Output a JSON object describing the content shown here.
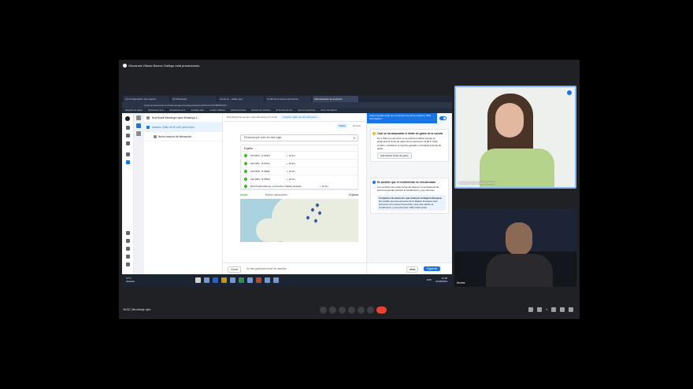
{
  "meet": {
    "banner": "Giovanna Vittoria Barros Gallego está presentando",
    "meeting_time": "16:02",
    "separator": "|",
    "meeting_code": "fta-ubwqz-ujov",
    "participant_count": "3"
  },
  "browser": {
    "tabs": [
      "(3) Configuración del negocio",
      "(2) WhatsApp",
      "Horno xo - citado ejec",
      "Confirma el correo electrónico",
      "Administrador de anuncios"
    ],
    "url": "business.facebook.com/adsmanager/manage/adsets/edit?act=1375485876337...",
    "bookmarks": [
      "Raspado de objeto...",
      "Declaración de lo...",
      "Declaración de lo...",
      "Unidades dpto...",
      "Cuadro: Médicos...",
      "Didáctica Dental...",
      "Noticias de Interésan...",
      "El Servicio de Hor...",
      "Qué es el planning...",
      "Otros marcadores"
    ]
  },
  "tree": {
    "campaign": "Bola Brasil Messenger para WhatsApp 2...",
    "adset": "Anuncio. 30km de 30 a 60 pinos mjho...",
    "ad": "Nuevo anuncio de Interacción"
  },
  "editor": {
    "crumbs": [
      "Bola Brasil Messenger para WhatsApp 04 10:10",
      "Anuncio. 30km de 30 a 60 pinos..."
    ],
    "modes": [
      "Editar",
      "Revisar"
    ],
    "audience_dropdown": "Personas que viven en este lugar",
    "country": "España",
    "locations": [
      {
        "name": "(42.9617, -8.4336)",
        "radius": "+ 10 km"
      },
      {
        "name": "(42.2201, -8.2751)",
        "radius": "+ 10 km"
      },
      {
        "name": "(42.2240, -8.4996)",
        "radius": "+ 10 km"
      },
      {
        "name": "(42.3394, -8.7806)",
        "radius": "+ 10 km"
      },
      {
        "name": "Rúa Pueblo Ramos, La Coruña, Galicia, España",
        "radius": "+ 10 km"
      }
    ],
    "include_label": "Incluir",
    "search_placeholder": "Buscar ubicaciones",
    "explore_label": "Explorar",
    "cancel_label": "Cerrar",
    "saved_text": "Se han guardado todos los cambios"
  },
  "panel": {
    "tip": "Ahora puedes estar de su anuncio los pinos empieza. Más información",
    "card1": {
      "title": "Casi se ha alcanzado el límite de gasto de la cuenta",
      "body": "En 2 días los anuncios no se podrán publicar porque se alcanzará el límite de gasto de la cuenta de 12,00 €. Para evitarlo, restablece el importe gastado o actualiza el límite de gasto.",
      "button": "Administrar límite de gasto"
    },
    "card2": {
      "title": "Es posible que el rendimiento se vea afectado",
      "body": "Los cambios que estén teniendo lugar en el ecosistema de anuncios pueden afectar al rendimiento y sus informes.",
      "inner_title": "Conjuntos de anuncios que incluyen la Región Europea",
      "inner_body": "Es posible que las personas de la Región Europea vean anuncios con menos frecuencia y que esto afecte al rendimiento y a los informes. Más información"
    },
    "back_label": "Atrás",
    "next_label": "Siguiente"
  },
  "taskbar": {
    "weather_temp": "17°C",
    "weather_desc": "Soleado",
    "tray": "ESP",
    "time": "12:38",
    "date": "24/05/2024"
  },
  "tiles": [
    {
      "name": "Giovanna Vittoria Barros Gallego"
    },
    {
      "name": "Nicolás"
    }
  ],
  "colors": {
    "accent": "#1b74e4",
    "end_call": "#ea4335",
    "meet_bg": "#202124"
  }
}
